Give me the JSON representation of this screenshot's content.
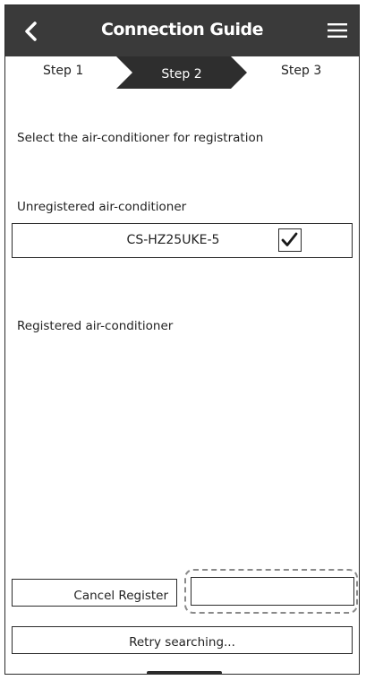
{
  "header": {
    "title": "Connection Guide",
    "back_icon": "chevron-left-icon",
    "menu_icon": "hamburger-menu-icon"
  },
  "steps": {
    "step1": "Step 1",
    "step2": "Step 2",
    "step3": "Step 3",
    "active": "Step 2"
  },
  "instruction": "Select the air-conditioner for registration",
  "unregistered": {
    "label": "Unregistered air-conditioner",
    "items": [
      {
        "name": "CS-HZ25UKE-5",
        "checked": true
      }
    ]
  },
  "registered": {
    "label": "Registered air-conditioner",
    "items": []
  },
  "buttons": {
    "cancel_register": "Cancel Register",
    "highlighted_blank": "",
    "retry": "Retry searching..."
  },
  "colors": {
    "header_bg": "#3a3a3a",
    "active_step_bg": "#2e2e2e",
    "border": "#2b2b2b",
    "highlight_dash": "#8a8a8a"
  }
}
